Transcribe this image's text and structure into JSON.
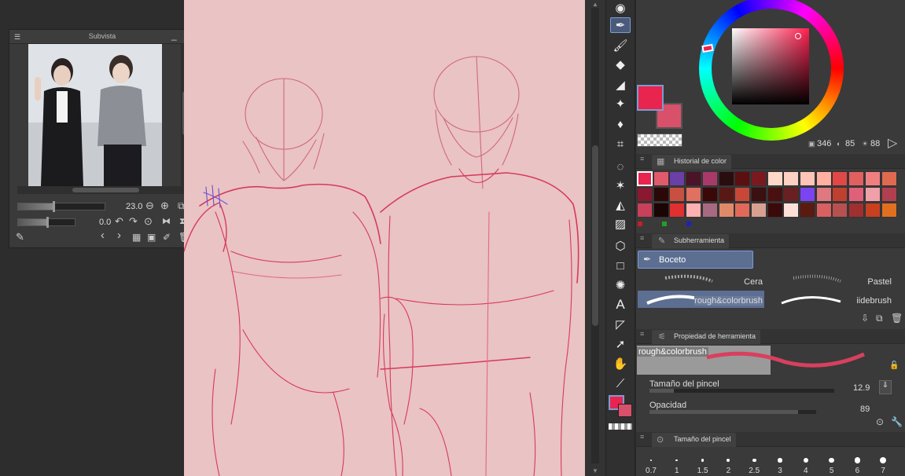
{
  "subview": {
    "title": "Subvista",
    "zoom_value": "23.0",
    "rotation_value": "0.0"
  },
  "color_panel": {
    "hsv_values": [
      "346",
      "85",
      "88"
    ],
    "main_color": "#e8244f",
    "sub_color": "#d9506a"
  },
  "color_history": {
    "tab_label": "Historial de color",
    "rows": [
      [
        "#e8244f",
        "#e05a6b",
        "#6a3fa6",
        "#4a1428",
        "#a83a6a",
        "#2a0d10",
        "#5a1010",
        "#7a1a20",
        "#ffd8c8",
        "#ffd0c4",
        "#ffc4b8",
        "#ffb0a0",
        "#e04848",
        "#e06060",
        "#f08080",
        "#e06a50"
      ],
      [
        "#8a1830",
        "#2a0808",
        "#c85040",
        "#e07060",
        "#3a0808",
        "#5a1814",
        "#c84838",
        "#3a1010",
        "#4a1010",
        "#6a2020",
        "#7a44f0",
        "#e07880",
        "#c04030",
        "#e0607a",
        "#f0a0a8",
        "#b04050"
      ],
      [
        "#c8405a",
        "#1a0404",
        "#e03030",
        "#ffb0b0",
        "#a86a80",
        "#e08a6a",
        "#e06a5a",
        "#d8a090",
        "#3a0a0a",
        "#ffe0d8",
        "#5a1a10",
        "#d86060",
        "#b85050",
        "#a03030",
        "#c84020",
        "#e07020"
      ]
    ],
    "markers": [
      "#c02020",
      "#20a020",
      "#2020c0"
    ]
  },
  "subtool": {
    "tab_label": "Subherramienta",
    "group": "Boceto",
    "brushes": [
      {
        "name": "Cera",
        "selected": false
      },
      {
        "name": "Pastel",
        "selected": false
      },
      {
        "name": "rough&colorbrush",
        "selected": true
      },
      {
        "name": "iidebrush",
        "selected": false
      }
    ]
  },
  "tool_property": {
    "tab_label": "Propiedad de herramienta",
    "brush_name": "rough&colorbrush",
    "size_label": "Tamaño del pincel",
    "size_value": "12.9",
    "size_level": 0.13,
    "opacity_label": "Opacidad",
    "opacity_value": "89",
    "opacity_level": 0.89
  },
  "brush_size": {
    "tab_label": "Tamaño del pincel",
    "sizes": [
      "0.7",
      "1",
      "1.5",
      "2",
      "2.5",
      "3",
      "4",
      "5",
      "6",
      "7"
    ]
  },
  "accent_color": "#7f9ad1",
  "canvas_color": "#eac3c4",
  "icons": [
    "eye-icon",
    "pen-icon",
    "brush-icon",
    "eraser-icon",
    "fill-icon",
    "sparkle-icon",
    "blend-icon",
    "grid-icon",
    "lasso-icon",
    "wand-icon",
    "bucket-icon",
    "gradient-icon",
    "cube-icon",
    "rect-icon",
    "burst-icon",
    "text-icon",
    "ruler-icon",
    "select-icon",
    "hand-icon",
    "dropper-icon"
  ]
}
